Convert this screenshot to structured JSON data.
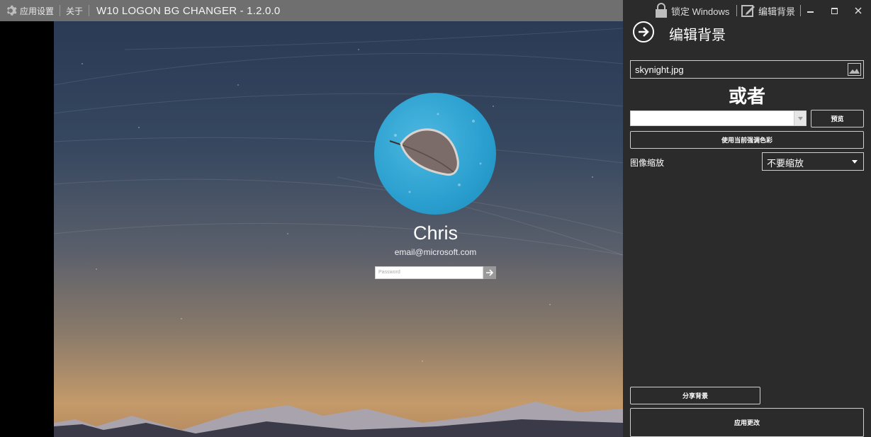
{
  "titlebar": {
    "settings_label": "应用设置",
    "about_label": "关于",
    "app_title": "W10 LOGON BG CHANGER - 1.2.0.0"
  },
  "panel_bar": {
    "lock_label": "锁定 Windows",
    "edit_bg_label": "编辑背景"
  },
  "login_preview": {
    "user_name": "Chris",
    "email": "email@microsoft.com",
    "password_placeholder": "Password"
  },
  "panel": {
    "title": "编辑背景",
    "file_value": "skynight.jpg",
    "or_label": "或者",
    "color_value": "",
    "preview_button": "预览",
    "accent_button": "使用当前强调色彩",
    "scale_label": "图像缩放",
    "scale_value": "不要缩放",
    "share_button": "分享背景",
    "apply_button": "应用更改"
  },
  "colors": {
    "titlebar": "#6f6f6f",
    "panel_bg": "#2b2b2b",
    "avatar": "#2a9fcf"
  }
}
